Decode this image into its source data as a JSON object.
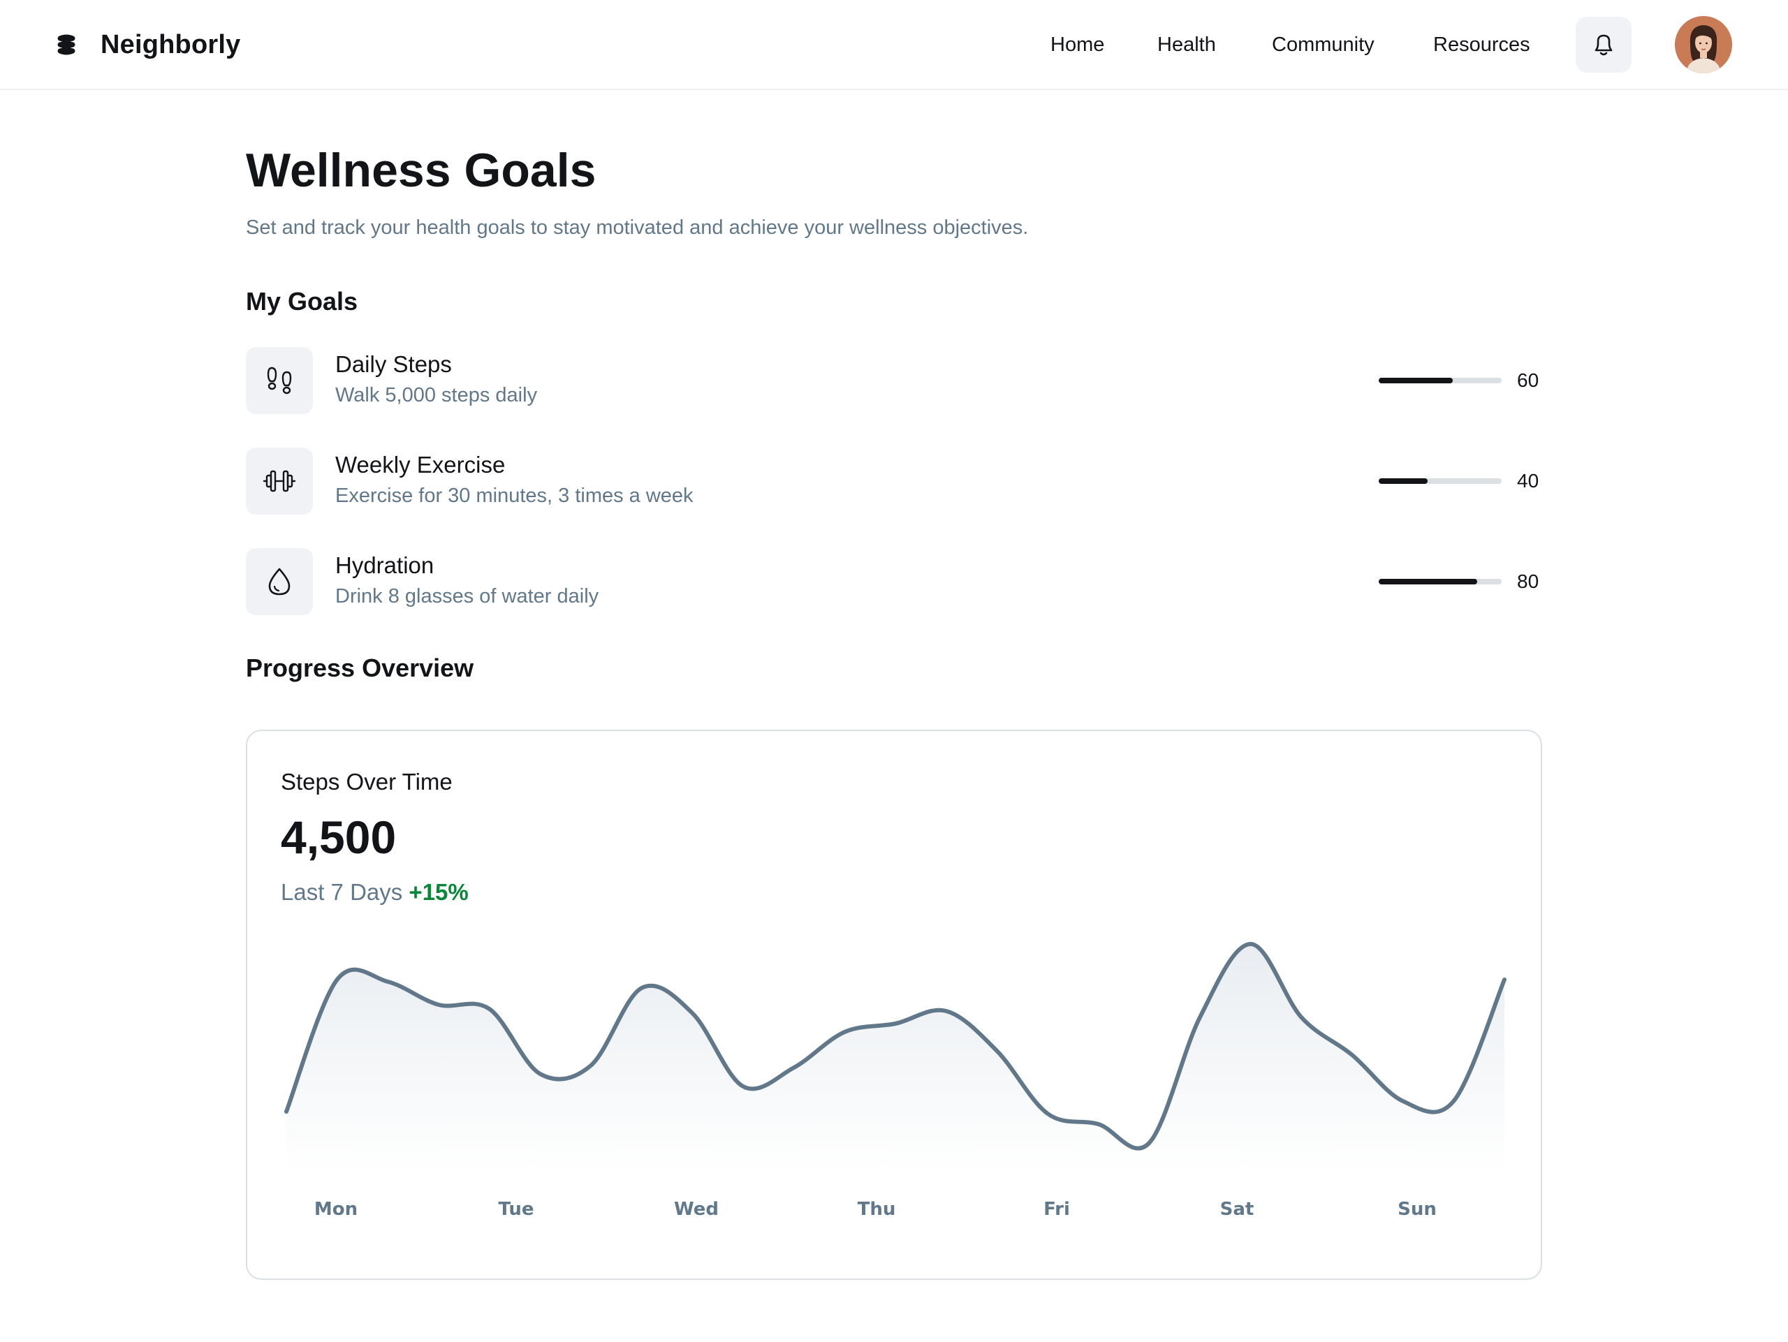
{
  "brand": {
    "name": "Neighborly"
  },
  "nav": {
    "links": [
      {
        "label": "Home"
      },
      {
        "label": "Health"
      },
      {
        "label": "Community"
      },
      {
        "label": "Resources"
      }
    ]
  },
  "page": {
    "title": "Wellness Goals",
    "subtitle": "Set and track your health goals to stay motivated and achieve your wellness objectives."
  },
  "goals_section": {
    "title": "My Goals",
    "items": [
      {
        "icon": "footprints-icon",
        "title": "Daily Steps",
        "description": "Walk 5,000 steps daily",
        "progress": 60,
        "progress_label": "60"
      },
      {
        "icon": "barbell-icon",
        "title": "Weekly Exercise",
        "description": "Exercise for 30 minutes, 3 times a week",
        "progress": 40,
        "progress_label": "40"
      },
      {
        "icon": "drop-icon",
        "title": "Hydration",
        "description": "Drink 8 glasses of water daily",
        "progress": 80,
        "progress_label": "80"
      }
    ]
  },
  "overview_section": {
    "title": "Progress Overview"
  },
  "steps_card": {
    "title": "Steps Over Time",
    "value": "4,500",
    "period": "Last 7 Days",
    "change": "+15%"
  },
  "colors": {
    "text_primary": "#121417",
    "text_secondary": "#61788a",
    "accent_positive": "#088738",
    "line": "#61788a",
    "track": "#dbe0e5",
    "icon_bg": "#f0f2f5"
  },
  "chart_data": {
    "type": "line",
    "title": "Steps Over Time",
    "categories": [
      "Mon",
      "Tue",
      "Wed",
      "Thu",
      "Fri",
      "Sat",
      "Sun"
    ],
    "x": [
      0,
      0.25,
      0.5,
      0.75,
      1,
      1.25,
      1.5,
      1.75,
      2,
      2.25,
      2.5,
      2.75,
      3,
      3.25,
      3.5,
      3.75,
      4,
      4.25,
      4.5,
      4.75,
      5,
      5.25,
      5.5,
      5.75,
      6
    ],
    "values": [
      15,
      78,
      77,
      66,
      64,
      33,
      37,
      74,
      62,
      27,
      36,
      53,
      57,
      63,
      44,
      14,
      9,
      0,
      60,
      95,
      60,
      42,
      20,
      20,
      78
    ],
    "ylim": [
      0,
      100
    ],
    "grid": false,
    "fill": true
  }
}
